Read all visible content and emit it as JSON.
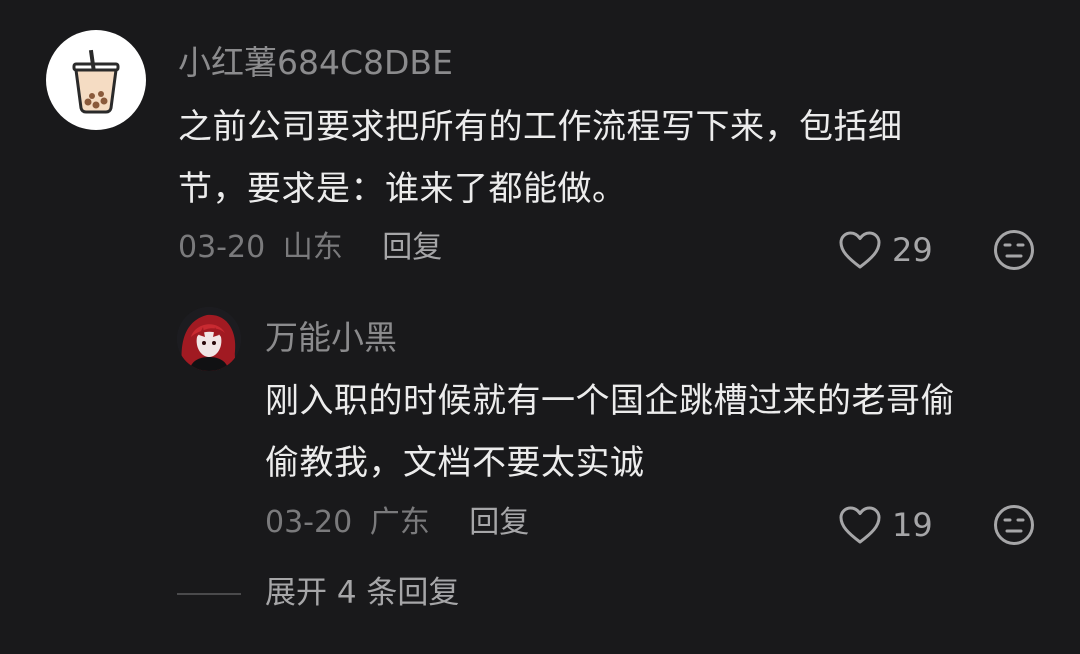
{
  "comments": [
    {
      "username": "小红薯684C8DBE",
      "content_line1": "之前公司要求把所有的工作流程写下来，包括细",
      "content_line2": "节，要求是：谁来了都能做。",
      "date": "03-20",
      "location": "山东",
      "reply_label": "回复",
      "likes": "29",
      "avatar_icon": "bubble-tea-icon"
    },
    {
      "username": "万能小黑",
      "content_line1": "刚入职的时候就有一个国企跳槽过来的老哥偷",
      "content_line2": "偷教我，文档不要太实诚",
      "date": "03-20",
      "location": "广东",
      "reply_label": "回复",
      "likes": "19",
      "avatar_icon": "anime-girl-avatar"
    }
  ],
  "expand_replies": "展开 4 条回复",
  "colors": {
    "background": "#19191b",
    "text_primary": "#ececec",
    "text_secondary": "#8b8b8d"
  }
}
